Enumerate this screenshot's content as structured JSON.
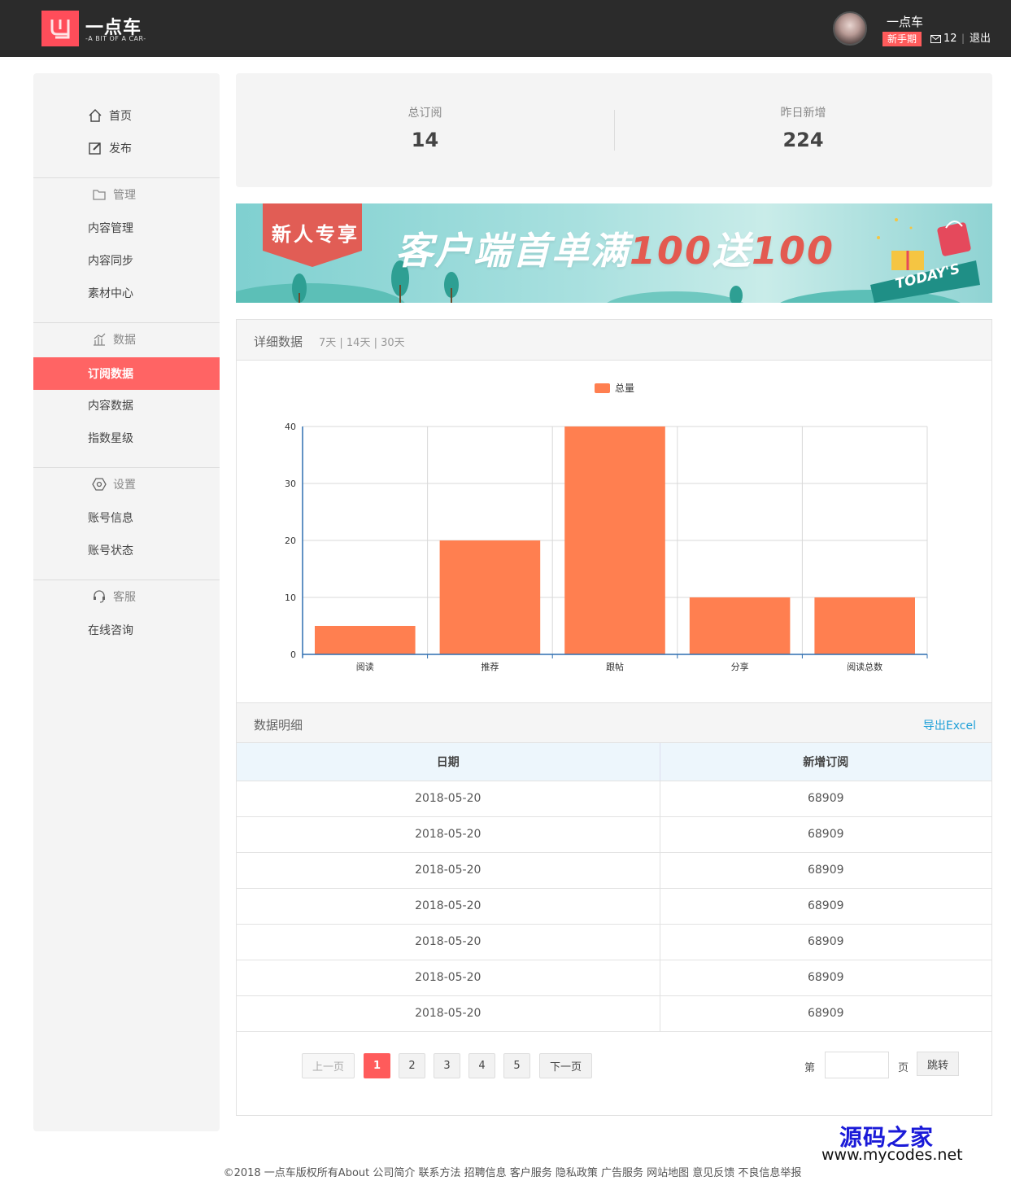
{
  "brand": {
    "name": "一点车",
    "tagline": "-A BIT OF A CAR-"
  },
  "user": {
    "name": "一点车",
    "level_badge": "新手期",
    "message_count": "12",
    "divider": "|",
    "logout_label": "退出"
  },
  "sidebar": {
    "home": "首页",
    "publish": "发布",
    "manage_head": "管理",
    "content_manage": "内容管理",
    "content_sync": "内容同步",
    "material_center": "素材中心",
    "data_head": "数据",
    "subscribe_data": "订阅数据",
    "content_data": "内容数据",
    "index_level": "指数星级",
    "settings_head": "设置",
    "account_info": "账号信息",
    "account_status": "账号状态",
    "service_head": "客服",
    "online_consult": "在线咨询"
  },
  "stats": {
    "total_label": "总订阅",
    "total_value": "14",
    "yesterday_label": "昨日新增",
    "yesterday_value": "224"
  },
  "banner": {
    "tag": "新人专享",
    "text": "客户端首单满",
    "amount1": "100",
    "give": "送",
    "amount2": "100",
    "today": "TODAY'S"
  },
  "detail": {
    "title": "详细数据",
    "ranges": "7天 | 14天 | 30天"
  },
  "chart_data": {
    "type": "bar",
    "categories": [
      "阅读",
      "推荐",
      "跟帖",
      "分享",
      "阅读总数"
    ],
    "series": [
      {
        "name": "总量",
        "values": [
          5,
          20,
          40,
          10,
          10
        ],
        "color": "#ff7f50"
      }
    ],
    "yticks": [
      "0",
      "10",
      "20",
      "30",
      "40"
    ],
    "ylim": [
      0,
      40
    ],
    "grid": true,
    "legend": "top-center"
  },
  "table": {
    "title": "数据明细",
    "export_label": "导出Excel",
    "headers": [
      "日期",
      "新增订阅"
    ],
    "rows": [
      [
        "2018-05-20",
        "68909"
      ],
      [
        "2018-05-20",
        "68909"
      ],
      [
        "2018-05-20",
        "68909"
      ],
      [
        "2018-05-20",
        "68909"
      ],
      [
        "2018-05-20",
        "68909"
      ],
      [
        "2018-05-20",
        "68909"
      ],
      [
        "2018-05-20",
        "68909"
      ]
    ]
  },
  "pager": {
    "prev": "上一页",
    "pages": [
      "1",
      "2",
      "3",
      "4",
      "5"
    ],
    "current": "1",
    "next": "下一页",
    "jump_prefix": "第",
    "jump_suffix": "页",
    "jump_button": "跳转"
  },
  "watermark": {
    "line1": "源码之家",
    "line2": "www.mycodes.net"
  },
  "footer": {
    "text": "©2018 一点车版权所有About 公司简介 联系方法 招聘信息 客户服务 隐私政策 广告服务 网站地图 意见反馈 不良信息举报"
  }
}
